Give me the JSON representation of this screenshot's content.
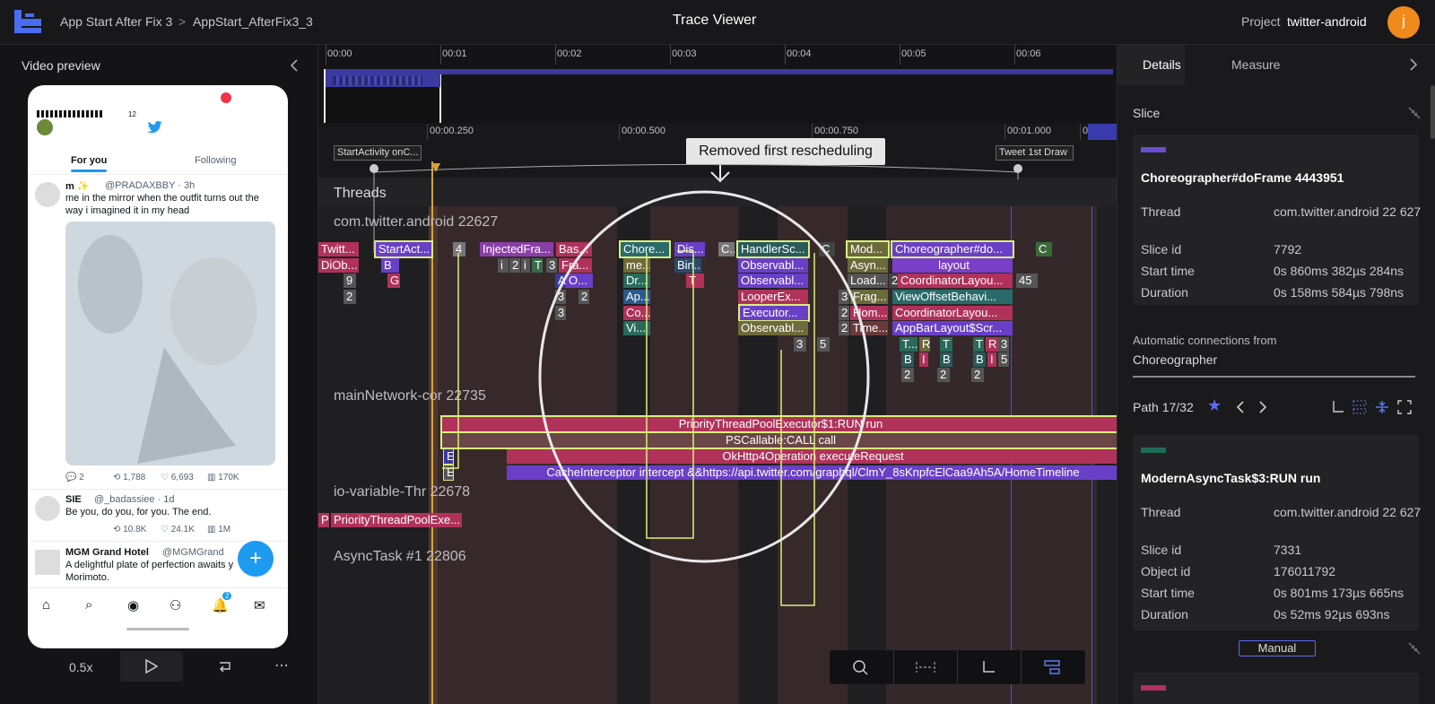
{
  "topbar": {
    "breadcrumb_1": "App Start After Fix 3",
    "breadcrumb_sep": ">",
    "breadcrumb_2": "AppStart_AfterFix3_3",
    "title": "Trace Viewer",
    "project_label": "Project",
    "project_name": "twitter-android",
    "avatar_initial": "j"
  },
  "video_preview": {
    "title": "Video preview",
    "speed": "0.5x",
    "phone": {
      "status_badge": "12",
      "tab_for_you": "For you",
      "tab_following": "Following",
      "tweet1": {
        "name": "m ✨",
        "handle": "@PRADAXBBY · 3h",
        "text1": "me in the mirror when the outfit turns out the",
        "text2": "way i imagined it in my head",
        "replies": "2",
        "retweets": "1,788",
        "likes": "6,693",
        "views": "170K"
      },
      "tweet2": {
        "name": "SIE",
        "handle": "@_badassiee · 1d",
        "text": "Be you, do you, for you. The end.",
        "retweets": "10.8K",
        "likes": "24.1K",
        "views": "1M"
      },
      "tweet3": {
        "name": "MGM Grand Hotel",
        "handle": "@MGMGrand",
        "text1": "A delightful plate of perfection awaits y",
        "text2": "Morimoto."
      },
      "notif_badge": "2"
    }
  },
  "timeline": {
    "overview_ticks": [
      "00:00",
      "00:01",
      "00:02",
      "00:03",
      "00:04",
      "00:05",
      "00:06"
    ],
    "detail_ticks": [
      "00:00.250",
      "00:00.500",
      "00:00.750",
      "00:01.000",
      "00:0"
    ],
    "markers": {
      "start": "StartActivity onC...",
      "end": "Tweet 1st Draw"
    },
    "annotation": "Removed first rescheduling",
    "threads_header": "Threads",
    "threads": [
      {
        "name": "com.twitter.android 22627"
      },
      {
        "name": "mainNetwork-cor 22735"
      },
      {
        "name": "io-variable-Thr 22678"
      },
      {
        "name": "AsyncTask #1 22806"
      }
    ],
    "main_slices_row1": [
      "Twitt...",
      "StartAct...",
      "4",
      "InjectedFra...",
      "Bas...",
      "Chore...",
      "Dis...",
      "C...",
      "HandlerSc...",
      "C",
      "Mod...",
      "Choreographer#do...",
      "C"
    ],
    "main_slices_row2": [
      "DiOb...",
      "B",
      "i",
      "2",
      "i",
      "T",
      "3",
      "Fra...",
      "me...",
      "Bin...",
      "Observabl...",
      "Asyn...",
      "layout"
    ],
    "main_slices_row3": [
      "9",
      "G",
      "A",
      "O...",
      "Dr...",
      "T",
      "Observabl...",
      "Load...",
      "2",
      "CoordinatorLayou...",
      "45"
    ],
    "main_slices_row4": [
      "2",
      "3",
      "2",
      "Ap...",
      "LooperEx...",
      "3",
      "Frag...",
      "ViewOffsetBehavi..."
    ],
    "main_slices_row5": [
      "3",
      "Co...",
      "Executor...",
      "2",
      "Hom...",
      "CoordinatorLayou..."
    ],
    "main_slices_row6": [
      "Vi...",
      "Observabl...",
      "2",
      "Time...",
      "AppBarLayout$Scr..."
    ],
    "main_slices_row7": [
      "3",
      "5",
      "T...",
      "R",
      "T",
      "T",
      "R",
      "3"
    ],
    "main_slices_row8": [
      "B",
      "I",
      "B",
      "B",
      "I",
      "5"
    ],
    "main_slices_row9": [
      "2",
      "2",
      "2"
    ],
    "network_slices": [
      "PriorityThreadPoolExecutor$1:RUN run",
      "PSCallable:CALL call",
      "OkHttp4Operation executeRequest",
      "CacheInterceptor intercept &&https://api.twitter.com/graphql/ClmY_8sKnpfcElCaa9Ah5A/HomeTimeline",
      "E",
      "E"
    ],
    "io_slices": [
      "P",
      "PriorityThreadPoolExe..."
    ]
  },
  "details": {
    "tab_details": "Details",
    "tab_measure": "Measure",
    "slice_header": "Slice",
    "slice1": {
      "title": "Choreographer#doFrame 4443951",
      "color": "#6a4fd0",
      "rows": [
        {
          "label": "Thread",
          "value": "com.twitter.android 22 627"
        },
        {
          "label": "Slice id",
          "value": "7792"
        },
        {
          "label": "Start time",
          "value": "0s 860ms 382µs 284ns"
        },
        {
          "label": "Duration",
          "value": "0s 158ms 584µs 798ns"
        }
      ]
    },
    "auto_conn_label": "Automatic connections from",
    "auto_conn_value": "Choreographer",
    "path": "Path 17/32",
    "slice2": {
      "title": "ModernAsyncTask$3:RUN run",
      "color": "#1f6b5a",
      "rows": [
        {
          "label": "Thread",
          "value": "com.twitter.android 22 627"
        },
        {
          "label": "Slice id",
          "value": "7331"
        },
        {
          "label": "Object id",
          "value": "176011792"
        },
        {
          "label": "Start time",
          "value": "0s 801ms 173µs 665ns"
        },
        {
          "label": "Duration",
          "value": "0s 52ms 92µs 693ns"
        }
      ]
    },
    "manual_label": "Manual"
  },
  "colors": {
    "accent": "#5b5bf0",
    "highlight": "#d8f07a",
    "pink": "#b0325a",
    "purple": "#6a3fc8",
    "brown": "#6e4646"
  }
}
